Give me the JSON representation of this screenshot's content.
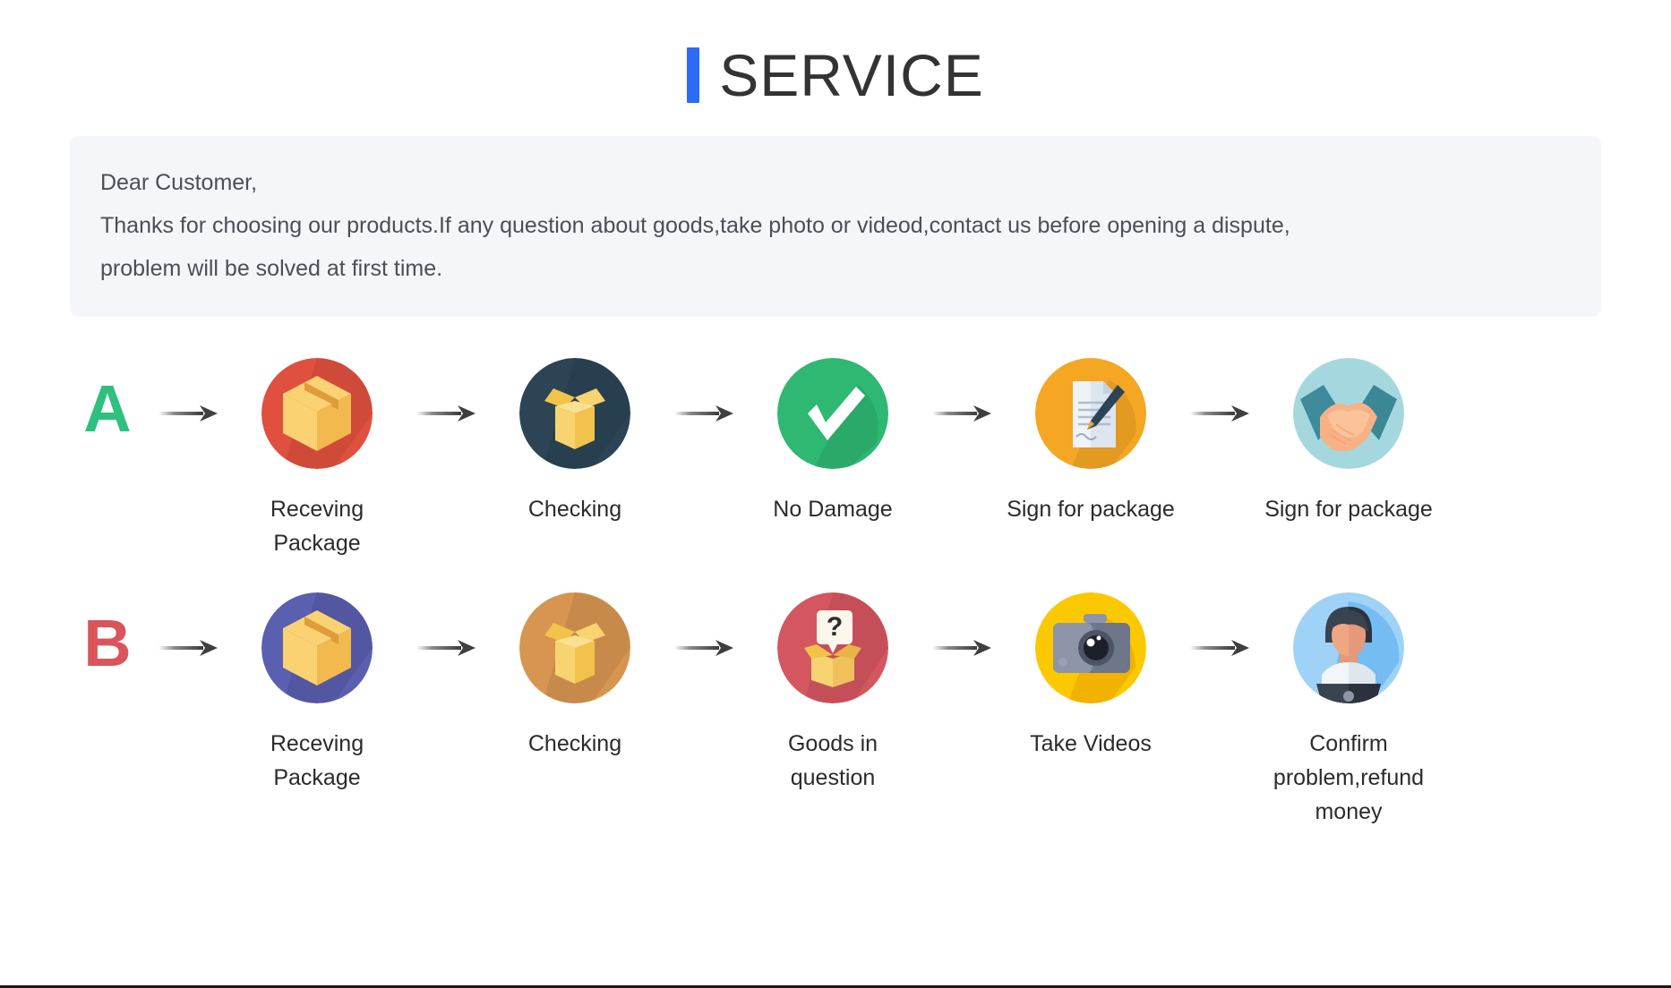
{
  "header": {
    "title": "SERVICE",
    "accent_color": "#2a6cf5"
  },
  "notice": {
    "line1": "Dear Customer,",
    "line2": "Thanks for choosing our products.If any question about goods,take photo or videod,contact us before opening a dispute,",
    "line3": "problem will be solved at first time.",
    "background_color": "#f4f6fa"
  },
  "flows": [
    {
      "letter": "A",
      "letter_color": "#2fbf7e",
      "steps": [
        {
          "label": "Receving Package",
          "icon": "closed-package-icon",
          "circle_color": "#e0503f"
        },
        {
          "label": "Checking",
          "icon": "open-box-icon",
          "circle_color": "#2c4456"
        },
        {
          "label": "No Damage",
          "icon": "check-mark-icon",
          "circle_color": "#2eb872"
        },
        {
          "label": "Sign for package",
          "icon": "document-pen-icon",
          "circle_color": "#f5a623"
        },
        {
          "label": "Sign for package",
          "icon": "handshake-icon",
          "circle_color": "#a5d8de"
        }
      ]
    },
    {
      "letter": "B",
      "letter_color": "#d9555b",
      "steps": [
        {
          "label": "Receving Package",
          "icon": "closed-package-icon",
          "circle_color": "#5b5fb0"
        },
        {
          "label": "Checking",
          "icon": "open-box-icon",
          "circle_color": "#d79551"
        },
        {
          "label": "Goods in question",
          "icon": "question-box-icon",
          "circle_color": "#d4565f"
        },
        {
          "label": "Take Videos",
          "icon": "camera-icon",
          "circle_color": "#fcc800"
        },
        {
          "label": "Confirm problem,refund money",
          "icon": "support-agent-icon",
          "circle_color": "#9fd2f7"
        }
      ]
    }
  ],
  "arrow": {
    "icon": "arrow-right-icon",
    "color": "#4a4a4a"
  }
}
